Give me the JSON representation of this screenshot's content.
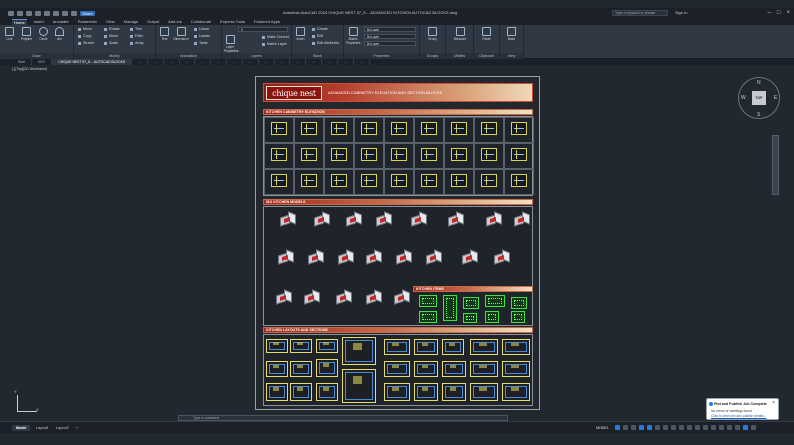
{
  "titlebar": {
    "title": "Autodesk AutoCAD 2024   CHIQUE NEST 57_K... ADVANCED KITCHEN AUTOCAD BLOCKS.dwg",
    "share_label": "Share",
    "search_placeholder": "Type a keyword or phrase",
    "user": "Sign In"
  },
  "ribbon_tabs": [
    "Home",
    "Insert",
    "Annotate",
    "Parametric",
    "View",
    "Manage",
    "Output",
    "Add-ins",
    "Collaborate",
    "Express Tools",
    "Featured Apps"
  ],
  "ribbon": {
    "draw": {
      "label": "Draw",
      "line": "Line",
      "polyline": "Polyline",
      "circle": "Circle",
      "arc": "Arc"
    },
    "modify": {
      "label": "Modify",
      "move": "Move",
      "rotate": "Rotate",
      "trim": "Trim",
      "copy": "Copy",
      "mirror": "Mirror",
      "fillet": "Fillet",
      "stretch": "Stretch",
      "scale": "Scale",
      "array": "Array"
    },
    "annotation": {
      "label": "Annotation",
      "text": "Text",
      "dimension": "Dimension",
      "linear": "Linear",
      "leader": "Leader",
      "table": "Table"
    },
    "layers": {
      "label": "Layers",
      "layer_properties": "Layer Properties",
      "layer_value": "0",
      "make_current": "Make Current",
      "match_layer": "Match Layer"
    },
    "block": {
      "label": "Block",
      "insert": "Insert",
      "create": "Create",
      "edit": "Edit",
      "edit_attributes": "Edit Attributes"
    },
    "properties": {
      "label": "Properties",
      "match": "Match Properties",
      "bylayer1": "ByLayer",
      "bylayer2": "ByLayer",
      "bylayer3": "ByLayer"
    },
    "groups": {
      "label": "Groups",
      "group": "Group"
    },
    "utilities": {
      "label": "Utilities",
      "measure": "Measure"
    },
    "clipboard": {
      "label": "Clipboard",
      "paste": "Paste"
    },
    "view": {
      "label": "View",
      "base": "Base"
    }
  },
  "filetabs": [
    "Start",
    "ISO*",
    "CHIQUE NEST 57_K... AUTOCAD BLOCKS",
    "...",
    "...",
    "...",
    "...",
    "...",
    "...",
    "...",
    "...",
    "...",
    "...",
    "...",
    "...",
    "...",
    "...",
    "..."
  ],
  "viewport": {
    "label": "[-][Top][2D Wireframe]"
  },
  "sheet": {
    "brand": "chique nest",
    "header_title": "ADVANCED CABINETRY ELEVATION AND SECTION BLOCKS",
    "sections": {
      "elevation": "KITCHEN CABINETRY ELEVATION",
      "iso": "ISO KITCHEN MODELS",
      "items": "KITCHEN ITEMS",
      "layouts": "KITCHEN LAYOUTS AND SECTIONS"
    }
  },
  "viewcube": {
    "face": "TOP",
    "n": "N",
    "s": "S",
    "e": "E",
    "w": "W"
  },
  "ucs": {
    "x": "X",
    "y": "Y"
  },
  "cmdline": {
    "placeholder": "Type a command"
  },
  "statusbar": {
    "tabs": [
      "Model",
      "Layout1",
      "Layout2",
      "+"
    ],
    "model_label": "MODEL"
  },
  "notification": {
    "title": "Plot and Publish Job Complete",
    "body": "No errors or warnings found",
    "link": "Click to view plot and publish details..."
  }
}
